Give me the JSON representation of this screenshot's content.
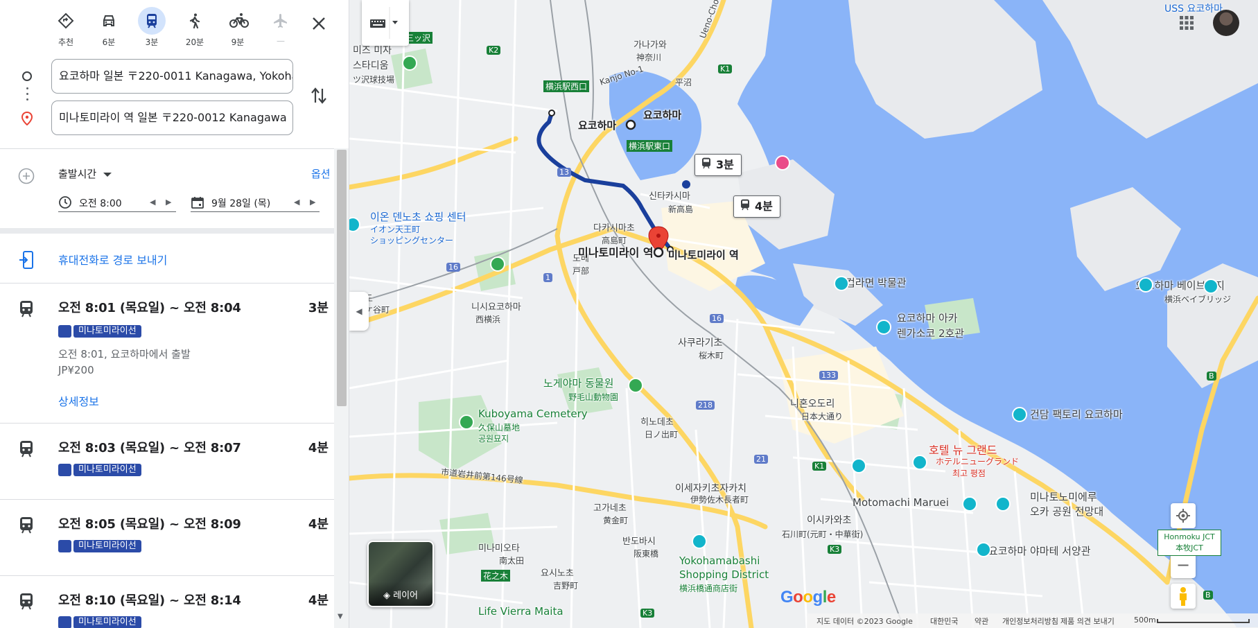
{
  "modes": [
    {
      "label": "추천",
      "icon": "diamond-route-icon"
    },
    {
      "label": "6분",
      "icon": "car-icon"
    },
    {
      "label": "3분",
      "icon": "train-icon"
    },
    {
      "label": "20분",
      "icon": "walk-icon"
    },
    {
      "label": "9분",
      "icon": "bicycle-icon"
    },
    {
      "label": "—",
      "icon": "airplane-icon"
    }
  ],
  "route": {
    "origin": "요코하마 일본 〒220-0011 Kanagawa, Yokohama",
    "destination": "미나토미라이 역 일본 〒220-0012 Kanagawa"
  },
  "options": {
    "depart_label": "출발시간",
    "options_link": "옵션",
    "time": "오전 8:00",
    "date": "9월 28일 (목)",
    "prev": "◀",
    "next": "▶"
  },
  "send_phone": "휴대전화로 경로 보내기",
  "trips": [
    {
      "times": "오전 8:01 (목요일) ~ 오전 8:04",
      "duration": "3분",
      "line": "미나토미라이선",
      "depart_info": "오전 8:01, 요코하마에서 출발",
      "fare": "JP¥200",
      "details": "상세정보"
    },
    {
      "times": "오전 8:03 (목요일) ~ 오전 8:07",
      "duration": "4분",
      "line": "미나토미라이선"
    },
    {
      "times": "오전 8:05 (목요일) ~ 오전 8:09",
      "duration": "4분",
      "line": "미나토미라이선"
    },
    {
      "times": "오전 8:10 (목요일) ~ 오전 8:14",
      "duration": "4분",
      "line": "미나토미라이선"
    }
  ],
  "map": {
    "duration_boxes": [
      "3분",
      "4분"
    ],
    "stations": {
      "yokohama": "요코하마",
      "yokohama_left": "요코하마",
      "minatomirai": "미나토미라이 역",
      "minatomirai_right": "미나토미라이 역"
    },
    "labels": {
      "misawa": "미즈 미자",
      "sutadiumu": "스타디움",
      "misawa_jp": "ツ沢球技場",
      "mitsuzawa_sign": "三ッ沢",
      "kanagawa": "가나가와",
      "kanagawa_jp": "神奈川",
      "ueno": "Ueno-Cho",
      "yokohama_west": "横浜駅西口",
      "yokohama_east": "横浜駅東口",
      "kanjo": "Kanjo No-1",
      "shintakashima": "신타카시마",
      "shintakashima_jp": "新高島",
      "aeon": "이온 덴노초 쇼핑 센터",
      "aeon_jp": "イオン天王町",
      "aeon_jp2": "ショッピングセンター",
      "takashimacho": "다카시마초",
      "takashimacho_jp": "高島町",
      "tobe": "도베",
      "tobe_jp": "戸部",
      "nishiyokohama": "니시요코하마",
      "nishiyokohama_jp": "西横浜",
      "hodogaya": "호도",
      "hodogaya_jp": "土ケ谷町",
      "sakuragicho": "사쿠라기초",
      "sakuragicho_jp": "桜木町",
      "nogeyama": "노게야마 동물원",
      "nogeyama_jp": "野毛山動物園",
      "kuboyama": "Kuboyama Cemetery",
      "kuboyama_jp": "久保山墓地",
      "kuboyama_kr": "공원묘지",
      "hinodecho": "히노데초",
      "hinodecho_jp": "日ノ出町",
      "nihon_odori": "니혼오도리",
      "nihon_odori_jp": "日本大通り",
      "hotel": "호텔 뉴 그랜드",
      "hotel_jp": "ホテルニューグランド",
      "hotel_rating": "최고 평점",
      "akarenga": "요코하마 아카",
      "akarenga2": "렌가소코 2호관",
      "cupnoodle": "컵라면 박물관",
      "factory": "건담 팩토리 요코하마",
      "baybridge": "요코하마 베이브리지",
      "baybridge_jp": "横浜ベイブリッジ",
      "isezakicho": "이세자키초자카치",
      "isezakicho_jp": "伊勢佐木長者町",
      "koganecho": "고가네초",
      "koganecho_jp": "黄金町",
      "bandobashi": "반도바시",
      "bandobashi_jp": "阪東橋",
      "ishikawacho": "이시카와초",
      "ishikawacho_jp": "石川町(元町・中華街)",
      "motomachi": "Motomachi Maruei",
      "minatonomieru": "미나토노미에루",
      "minatonomieru2": "오카 공원 전망대",
      "yamate": "요코하마 야마테 서양관",
      "minamiota": "미나미오타",
      "minamiota_jp": "南太田",
      "yoshinocho": "요시노초",
      "yoshinocho_jp": "吉野町",
      "hanoki": "花之木",
      "shopping": "Yokohamabashi",
      "shopping2": "Shopping District",
      "shopping_jp": "横浜橋通商店街",
      "lifevierra": "Life Vierra Maita",
      "ichidori": "市道岩井前第146号線",
      "uss": "USS 요코하마",
      "hirayama": "平沼"
    },
    "routes": [
      "K2",
      "K1",
      "13",
      "16",
      "1",
      "16",
      "218",
      "133",
      "21",
      "K1",
      "K3",
      "K3",
      "B",
      "B"
    ],
    "layer_label": "레이어",
    "honmoku": "Honmoku JCT",
    "honmoku_jp": "本牧JCT",
    "google": [
      "G",
      "o",
      "o",
      "g",
      "l",
      "e"
    ],
    "footer": {
      "data": "지도 데이터 ©2023 Google",
      "country": "대한민국",
      "terms": "약관",
      "privacy": "개인정보처리방침",
      "feedback": "제품 의견 보내기",
      "scale": "500m"
    }
  }
}
